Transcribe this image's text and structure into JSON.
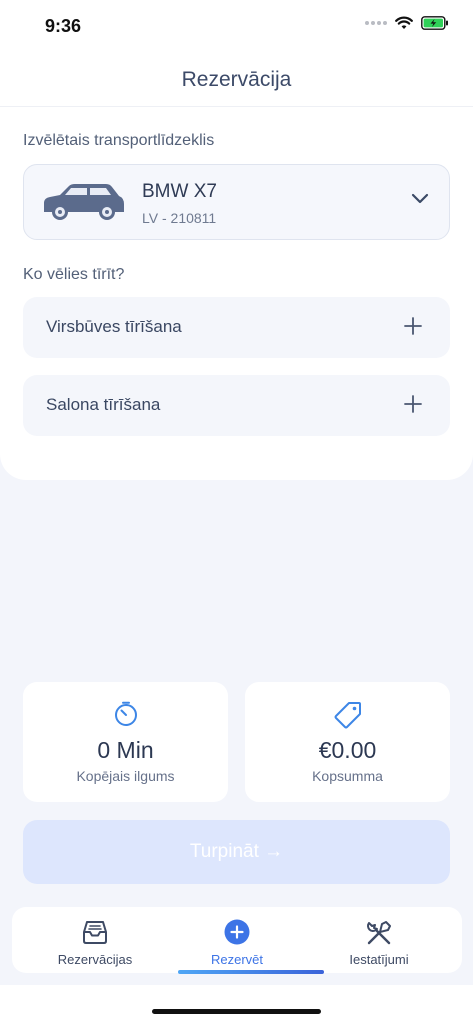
{
  "status_bar": {
    "time": "9:36",
    "battery_color": "#2fd158"
  },
  "header": {
    "title": "Rezervācija"
  },
  "vehicle_section": {
    "label": "Izvēlētais transportlīdzeklis",
    "vehicle": {
      "name": "BMW X7",
      "plate": "LV - 210811",
      "icon": "car-icon"
    }
  },
  "services_section": {
    "label": "Ko vēlies tīrīt?",
    "items": [
      {
        "label": "Virsbūves tīrīšana"
      },
      {
        "label": "Salona tīrīšana"
      }
    ]
  },
  "summary": {
    "duration": {
      "value": "0 Min",
      "label": "Kopējais ilgums",
      "icon": "timer-icon"
    },
    "total": {
      "value": "€0.00",
      "label": "Kopsumma",
      "icon": "price-tag-icon"
    }
  },
  "continue_button": {
    "label": "Turpināt →",
    "state": "disabled"
  },
  "tabbar": {
    "items": [
      {
        "label": "Rezervācijas",
        "icon": "inbox-icon"
      },
      {
        "label": "Rezervēt",
        "icon": "plus-circle-icon",
        "active": true
      },
      {
        "label": "Iestatījumi",
        "icon": "tools-icon"
      }
    ]
  },
  "colors": {
    "accent": "#3d74e6",
    "text": "#3b4a66",
    "background": "#f3f5fb"
  }
}
